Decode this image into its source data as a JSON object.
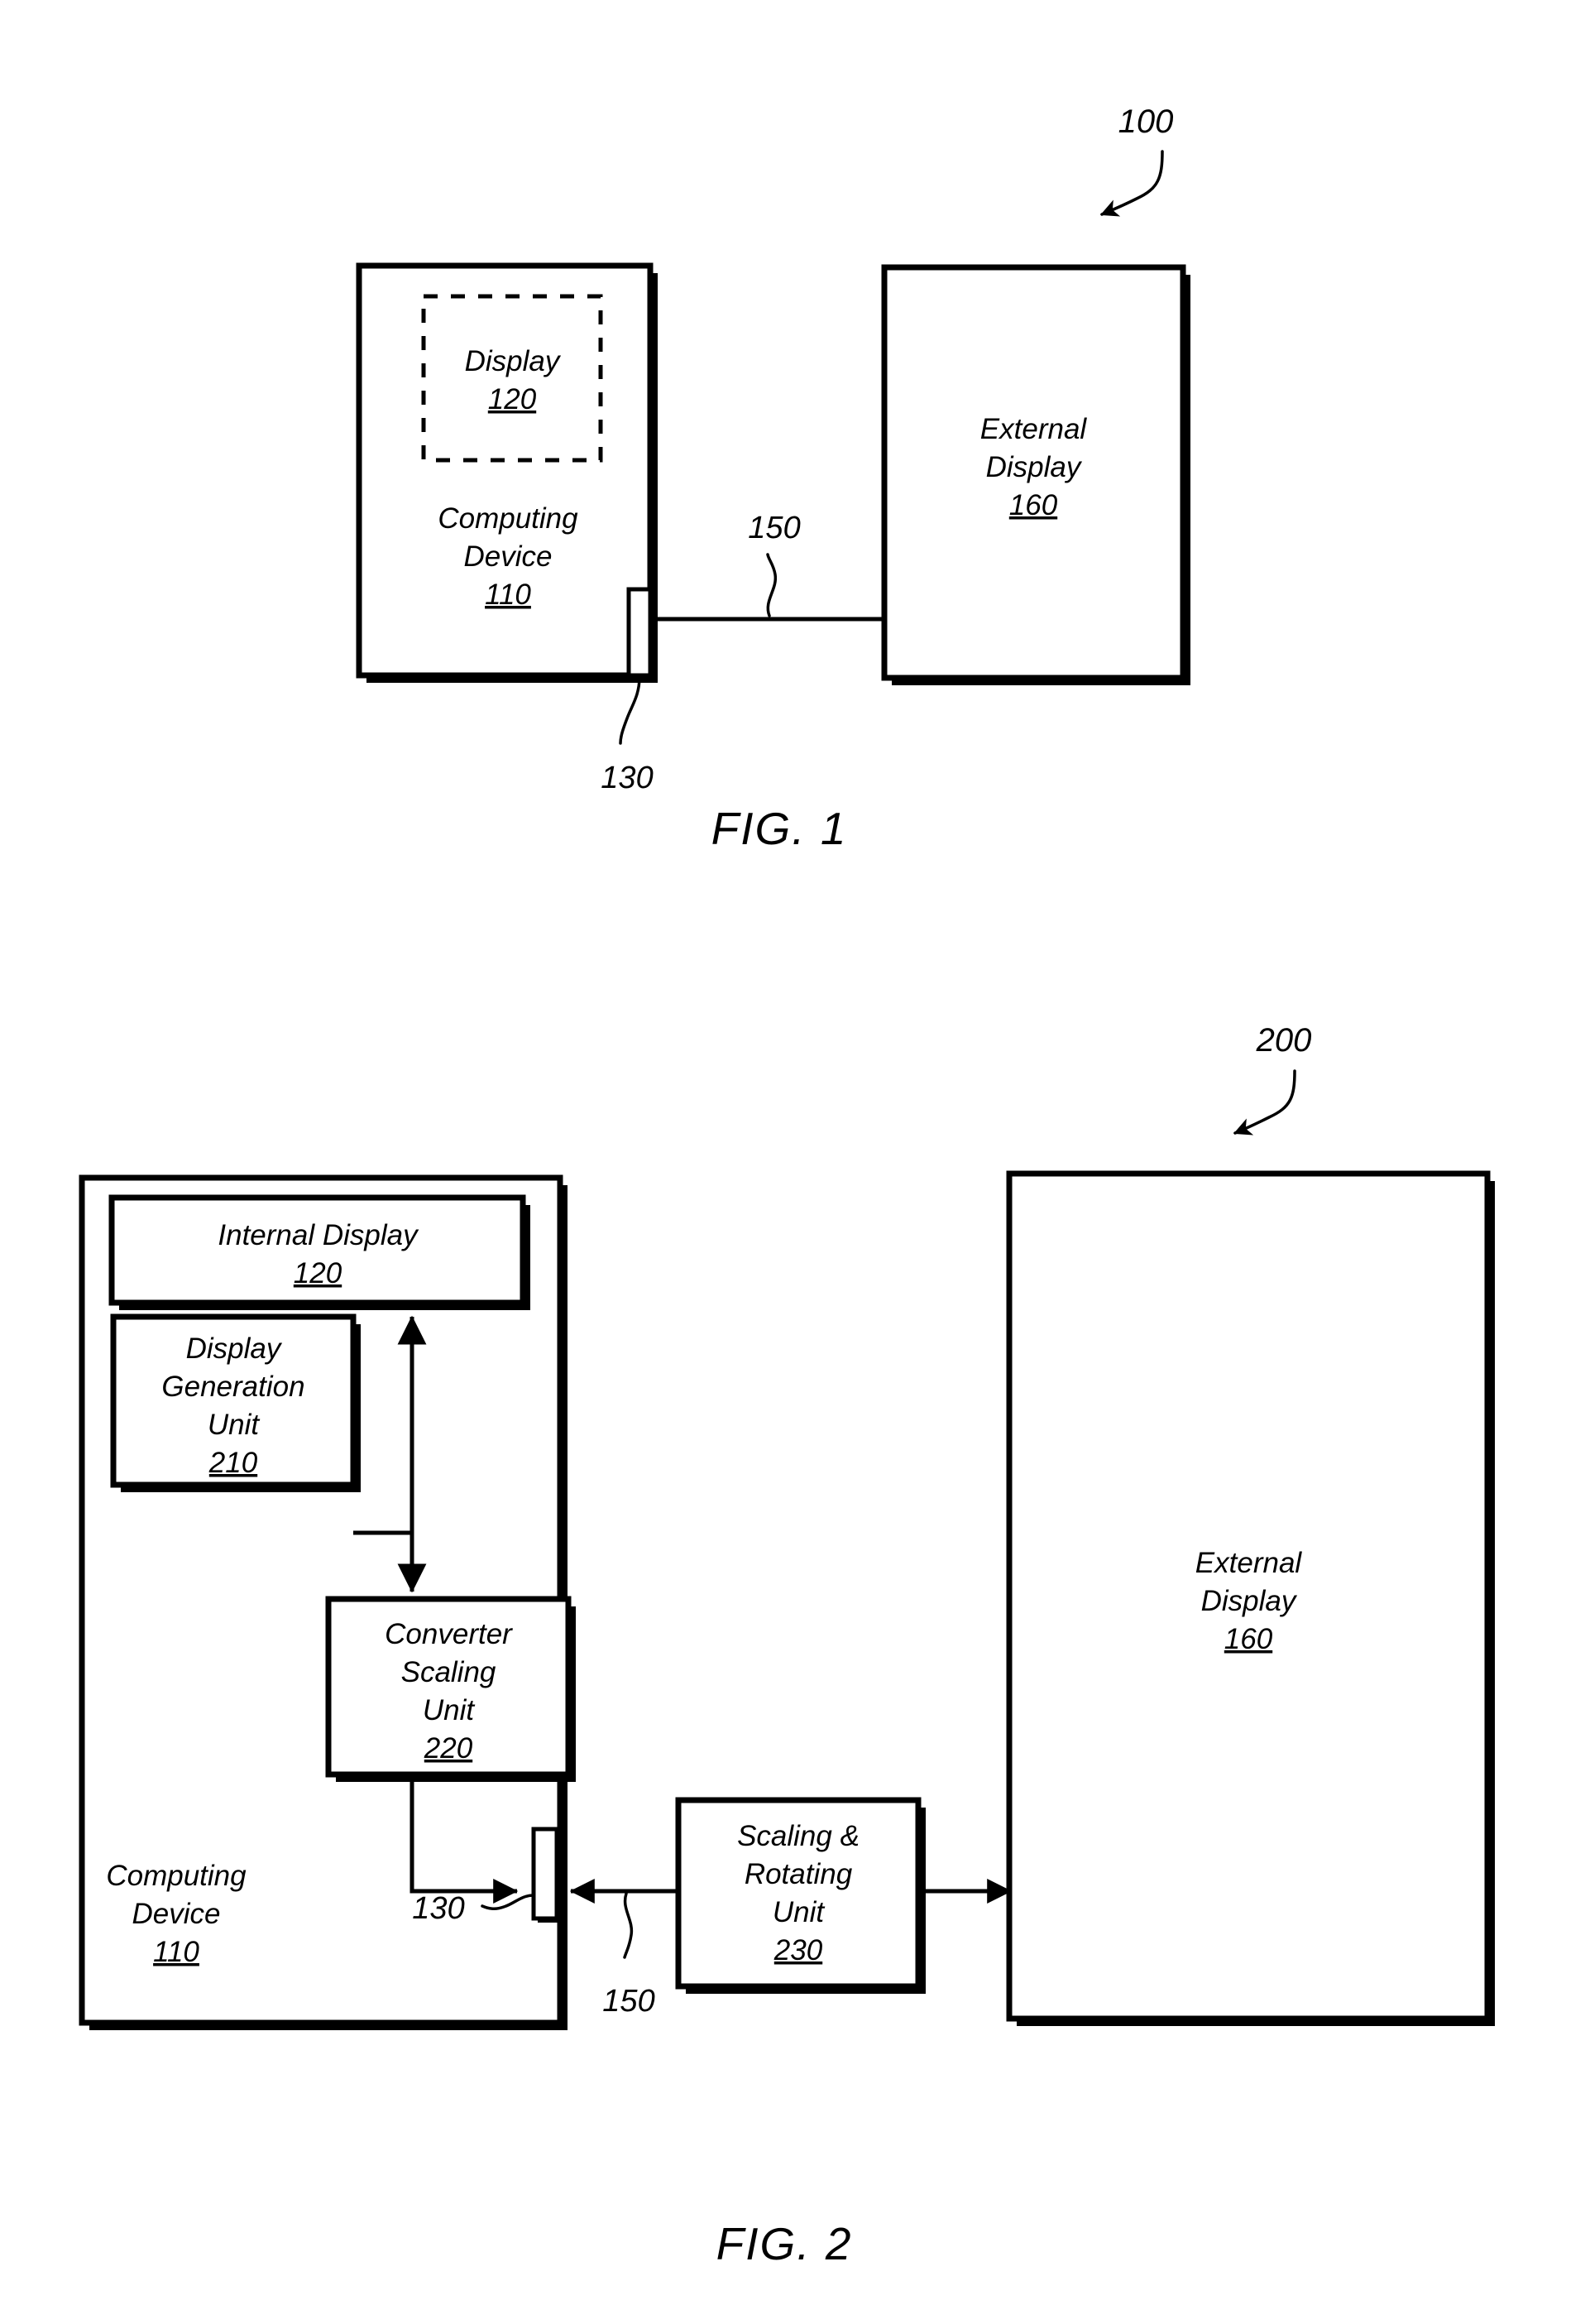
{
  "document": {
    "type": "patent-drawing-sheet",
    "figures": [
      "FIG. 1",
      "FIG. 2"
    ]
  },
  "fig1": {
    "caption": "FIG. 1",
    "system_ref": "100",
    "computing_device": {
      "line1": "Computing",
      "line2": "Device",
      "ref": "110"
    },
    "display": {
      "line1": "Display",
      "ref": "120"
    },
    "connector_ref": "130",
    "cable_ref": "150",
    "external_display": {
      "line1": "External",
      "line2": "Display",
      "ref": "160"
    }
  },
  "fig2": {
    "caption": "FIG. 2",
    "system_ref": "200",
    "computing_device": {
      "line1": "Computing",
      "line2": "Device",
      "ref": "110"
    },
    "internal_display": {
      "line1": "Internal Display",
      "ref": "120"
    },
    "display_generation_unit": {
      "line1": "Display",
      "line2": "Generation",
      "line3": "Unit",
      "ref": "210"
    },
    "converter_scaling_unit": {
      "line1": "Converter",
      "line2": "Scaling",
      "line3": "Unit",
      "ref": "220"
    },
    "scaling_rotating_unit": {
      "line1": "Scaling &",
      "line2": "Rotating",
      "line3": "Unit",
      "ref": "230"
    },
    "connector_ref": "130",
    "cable_ref": "150",
    "external_display": {
      "line1": "External",
      "line2": "Display",
      "ref": "160"
    }
  },
  "colors": {
    "ink": "#000000",
    "paper": "#ffffff"
  }
}
